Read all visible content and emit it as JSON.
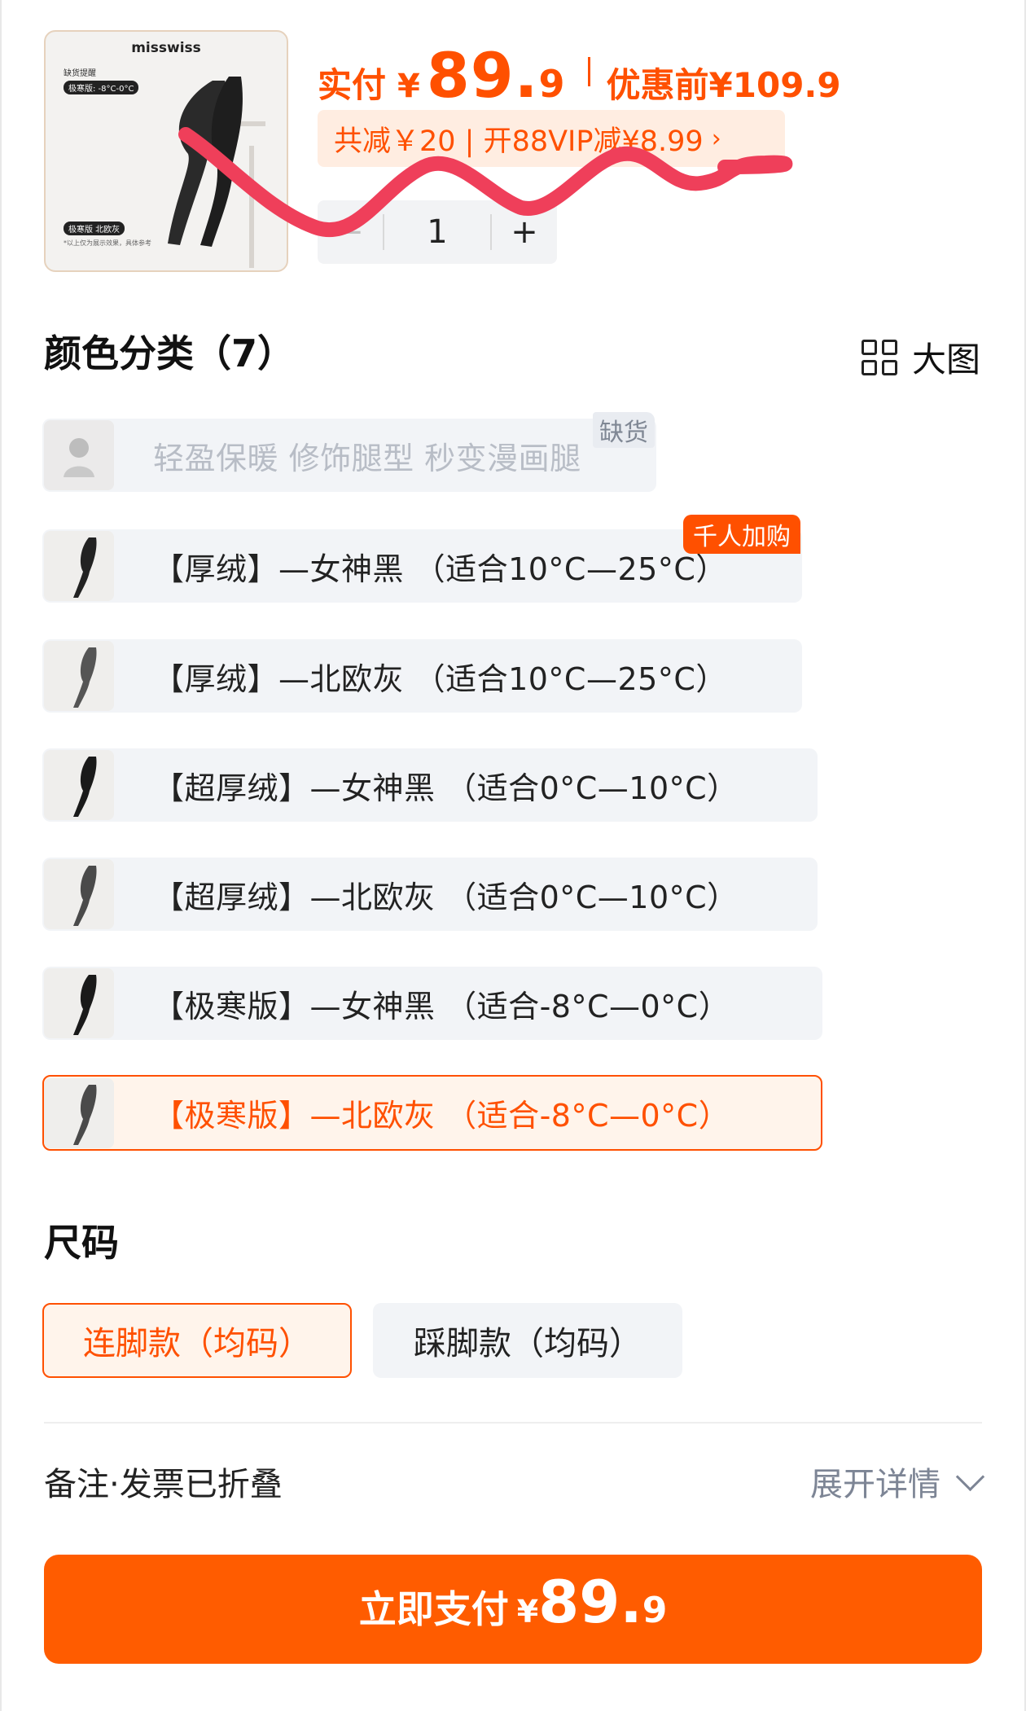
{
  "product": {
    "brand": "misswiss",
    "thumb_tag1": "缺货提醒",
    "thumb_tag2": "极寒版: -8°C-0°C",
    "thumb_tag3": "极寒版 北欧灰",
    "thumb_tag4": "*以上仅为展示效果，具体参考"
  },
  "price": {
    "paid_label": "实付",
    "currency": "¥",
    "paid_int": "89.",
    "paid_dec": "9",
    "original_label": "优惠前",
    "original_value": "¥109.9"
  },
  "discount": {
    "text": "共减￥20 | 开88VIP减¥8.99",
    "chevron": "›"
  },
  "quantity": {
    "minus": "−",
    "value": "1",
    "plus": "+"
  },
  "color_section": {
    "title": "颜色分类（7）",
    "big_image_label": "大图",
    "options": [
      {
        "label": "轻盈保暖 修饰腿型 秒变漫画腿",
        "state": "disabled",
        "badge": "缺货"
      },
      {
        "label": "【厚绒】—女神黑 （适合10°C—25°C）",
        "state": "normal",
        "badge": "千人加购"
      },
      {
        "label": "【厚绒】—北欧灰 （适合10°C—25°C）",
        "state": "normal",
        "badge": ""
      },
      {
        "label": "【超厚绒】—女神黑 （适合0°C—10°C）",
        "state": "normal",
        "badge": ""
      },
      {
        "label": "【超厚绒】—北欧灰 （适合0°C—10°C）",
        "state": "normal",
        "badge": ""
      },
      {
        "label": "【极寒版】—女神黑 （适合-8°C—0°C）",
        "state": "normal",
        "badge": ""
      },
      {
        "label": "【极寒版】—北欧灰 （适合-8°C—0°C）",
        "state": "selected",
        "badge": ""
      }
    ]
  },
  "size_section": {
    "title": "尺码",
    "options": [
      {
        "label": "连脚款（均码）",
        "state": "selected"
      },
      {
        "label": "踩脚款（均码）",
        "state": "normal"
      }
    ]
  },
  "remark": {
    "label": "备注·发票已折叠",
    "expand_label": "展开详情"
  },
  "pay_button": {
    "label": "立即支付",
    "currency": "¥",
    "int": "89.",
    "dec": "9"
  },
  "colors": {
    "accent": "#ff5000",
    "scribble": "#ef3f5a"
  }
}
